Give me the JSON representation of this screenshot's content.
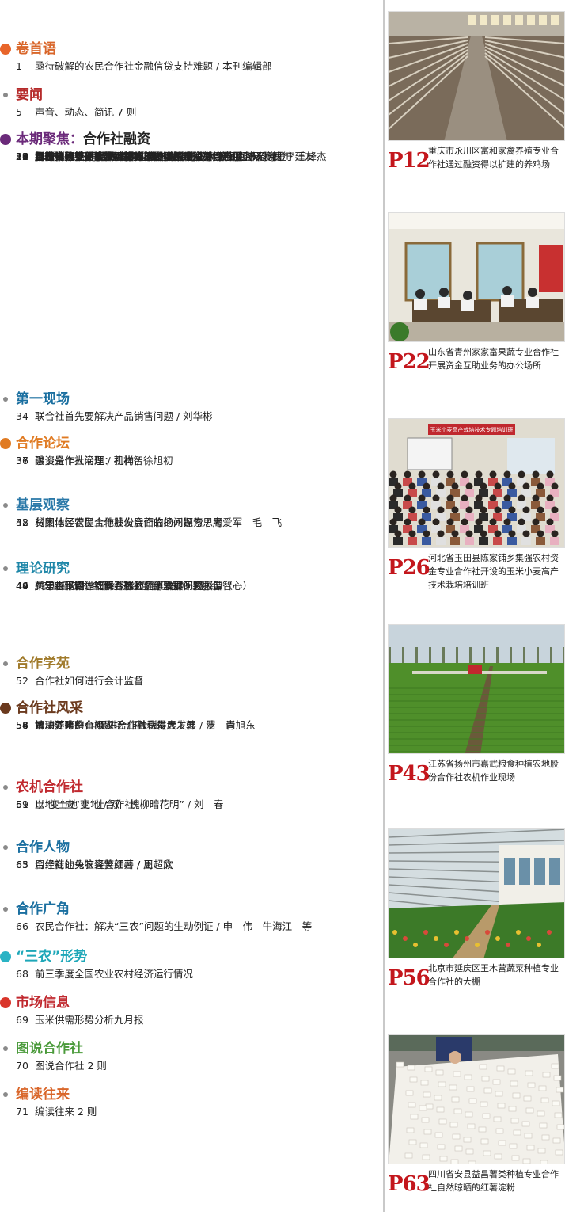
{
  "sections": [
    {
      "title": "卷首语",
      "subtitle": "",
      "title_color": "#d9662a",
      "dot_color": "#e8652a",
      "items": [
        {
          "num": "1",
          "title": "亟待破解的农民合作社金融信贷支持难题 / 本刊编辑部"
        }
      ]
    },
    {
      "title": "要闻",
      "subtitle": "",
      "title_color": "#b52a2a",
      "dot_color": "#8a8a8a",
      "items": [
        {
          "num": "5",
          "title": "声音、动态、简讯 7 则"
        }
      ]
    },
    {
      "title": "本期聚焦：",
      "subtitle": "合作社融资",
      "title_color": "#6b2a7a",
      "dot_color": "#6b2a7a",
      "items": [
        {
          "num": "8",
          "title": "山东：规范创新 探索农村合作金融新机制 / 张克新"
        },
        {
          "num": "10",
          "title": "吉林省积极为合作社等经营主体创造良好金融服务环境"
        },
        {
          "num": "",
          "title": "/ 史东兴　王青海　等"
        },
        {
          "num": "12",
          "title": "创新合作社财政投入模式 促进合作社做大做强 / 陈光涛　李廷友"
        },
        {
          "num": "14",
          "title": "金融支持合作社发展模式探析 / 赵　海"
        },
        {
          "num": "16",
          "title": "农民合作社发展信用合作的必要性和三条“硬杠杠” / 刘西川"
        },
        {
          "num": "19",
          "title": "用“产业链 + 大数据”的办法解决农业贷款难问题 / 周海登　王峰杰"
        },
        {
          "num": "21",
          "title": "探索信用互助 促进增收致富 / 刘华彬"
        },
        {
          "num": "24",
          "title": "不忘初心 方得始终 / 刘　云　谢祷施"
        },
        {
          "num": "26",
          "title": "集强合作社：余缺调剂实现资金融通 / 吴　岩"
        },
        {
          "num": "28",
          "title": "零钱聚整钱 小钱大用场 / 杜东方"
        },
        {
          "num": "29",
          "title": "合作社：不要让资金枯竭了发展的希望 / 周忠丽　双　槐"
        },
        {
          "num": "33",
          "title": "合作社人支招合作社融资"
        }
      ]
    },
    {
      "title": "第一现场",
      "subtitle": "",
      "title_color": "#1a6fa0",
      "dot_color": "#8a8a8a",
      "items": [
        {
          "num": "34",
          "title": "联合社首先要解决产品销售问题 / 刘华彬"
        }
      ]
    },
    {
      "title": "合作论坛",
      "subtitle": "",
      "title_color": "#e07b23",
      "dot_color": "#e07b23",
      "items": [
        {
          "num": "36",
          "title": "谈谈合作社治理：机构 / 徐旭初"
        },
        {
          "num": "37",
          "title": "融资是个大问题 / 孔祥智"
        }
      ]
    },
    {
      "title": "基层观察",
      "subtitle": "",
      "title_color": "#2a78a8",
      "dot_color": "#8a8a8a",
      "items": [
        {
          "num": "38",
          "title": "贫困地区农民合作社发展面临的问题与思考"
        },
        {
          "num": "42",
          "title": "村集体经营型土地股份合作的扬州探索 / 周爱军　毛　飞"
        }
      ]
    },
    {
      "title": "理论研究",
      "subtitle": "",
      "title_color": "#1f87a8",
      "dot_color": "#8a8a8a",
      "items": [
        {
          "num": "44",
          "title": "新常态下促进农民合作社健康发展研究报告（一）"
        },
        {
          "num": "",
          "title": "/ 农业部农村合作经济经营管理总站课题组"
        },
        {
          "num": "46",
          "title": "十年合作路　巧降养殖险 / 傅琳琳"
        },
        {
          "num": "49",
          "title": "关于农民合作社联合社的几个法律问题 / 谭智心"
        }
      ]
    },
    {
      "title": "合作学苑",
      "subtitle": "",
      "title_color": "#a07a2a",
      "dot_color": "#8a8a8a",
      "items": [
        {
          "num": "52",
          "title": "合作社如何进行会计监督"
        }
      ]
    },
    {
      "title": "合作社风采",
      "subtitle": "",
      "title_color": "#6b3a1e",
      "dot_color": "#6b3a1e",
      "items": [
        {
          "num": "54",
          "title": "解决养殖户小问题 合作社获得大发展 / 罗　青"
        },
        {
          "num": "56",
          "title": "妫川河畔的有机农场 / 孙超超"
        },
        {
          "num": "58",
          "title": "推动要素整合 促进产业融合发展 / 韩　洁　尚旭东"
        }
      ]
    },
    {
      "title": "农机合作社",
      "subtitle": "",
      "title_color": "#c0282e",
      "dot_color": "#8a8a8a",
      "items": [
        {
          "num": "59",
          "title": "土地 土地 土地 / 双　槐"
        },
        {
          "num": "61",
          "title": "以“变”应“变”让合作社“柳暗花明” / 刘　春"
        }
      ]
    },
    {
      "title": "合作人物",
      "subtitle": "",
      "title_color": "#1a6fa0",
      "dot_color": "#8a8a8a",
      "items": [
        {
          "num": "63",
          "title": "用经商的头脑经营红薯 / 王　欣"
        },
        {
          "num": "65",
          "title": "合作社让兔农喜笑颜开 / 周超文"
        }
      ]
    },
    {
      "title": "合作广角",
      "subtitle": "",
      "title_color": "#1a6fa0",
      "dot_color": "#8a8a8a",
      "items": [
        {
          "num": "66",
          "title": "农民合作社：解决“三农”问题的生动例证 / 申　伟　牛海江　等"
        }
      ]
    },
    {
      "title": "“三农”形势",
      "subtitle": "",
      "title_color": "#1ea7b8",
      "dot_color": "#2ab3c4",
      "items": [
        {
          "num": "68",
          "title": "前三季度全国农业农村经济运行情况"
        }
      ]
    },
    {
      "title": "市场信息",
      "subtitle": "",
      "title_color": "#c0282e",
      "dot_color": "#d9352a",
      "items": [
        {
          "num": "69",
          "title": "玉米供需形势分析九月报"
        }
      ]
    },
    {
      "title": "图说合作社",
      "subtitle": "",
      "title_color": "#4a9a3a",
      "dot_color": "#8a8a8a",
      "items": [
        {
          "num": "70",
          "title": "图说合作社 2 则"
        }
      ]
    },
    {
      "title": "编读往来",
      "subtitle": "",
      "title_color": "#d9662a",
      "dot_color": "#8a8a8a",
      "items": [
        {
          "num": "71",
          "title": "编读往来 2 则"
        }
      ]
    }
  ],
  "photos": [
    {
      "page": "P12",
      "caption": "重庆市永川区富和家禽养殖专业合作社通过融资得以扩建的养鸡场",
      "scene": "poultry-house"
    },
    {
      "page": "P22",
      "caption": "山东省青州家家富果蔬专业合作社开展资金互助业务的办公场所",
      "scene": "office"
    },
    {
      "page": "P26",
      "caption": "河北省玉田县陈家铺乡集强农村资金专业合作社开设的玉米小麦高产技术栽培培训班",
      "scene": "training-class",
      "banner": "玉米小麦高产栽培技术专题培训班"
    },
    {
      "page": "P43",
      "caption": "江苏省扬州市嘉武粮食种植农地股份合作社农机作业现场",
      "scene": "wheat-field"
    },
    {
      "page": "P56",
      "caption": "北京市延庆区王木营蔬菜种植专业合作社的大棚",
      "scene": "greenhouse"
    },
    {
      "page": "P63",
      "caption": "四川省安县益昌薯类种植专业合作社自然晾晒的红薯淀粉",
      "scene": "starch-drying"
    }
  ]
}
